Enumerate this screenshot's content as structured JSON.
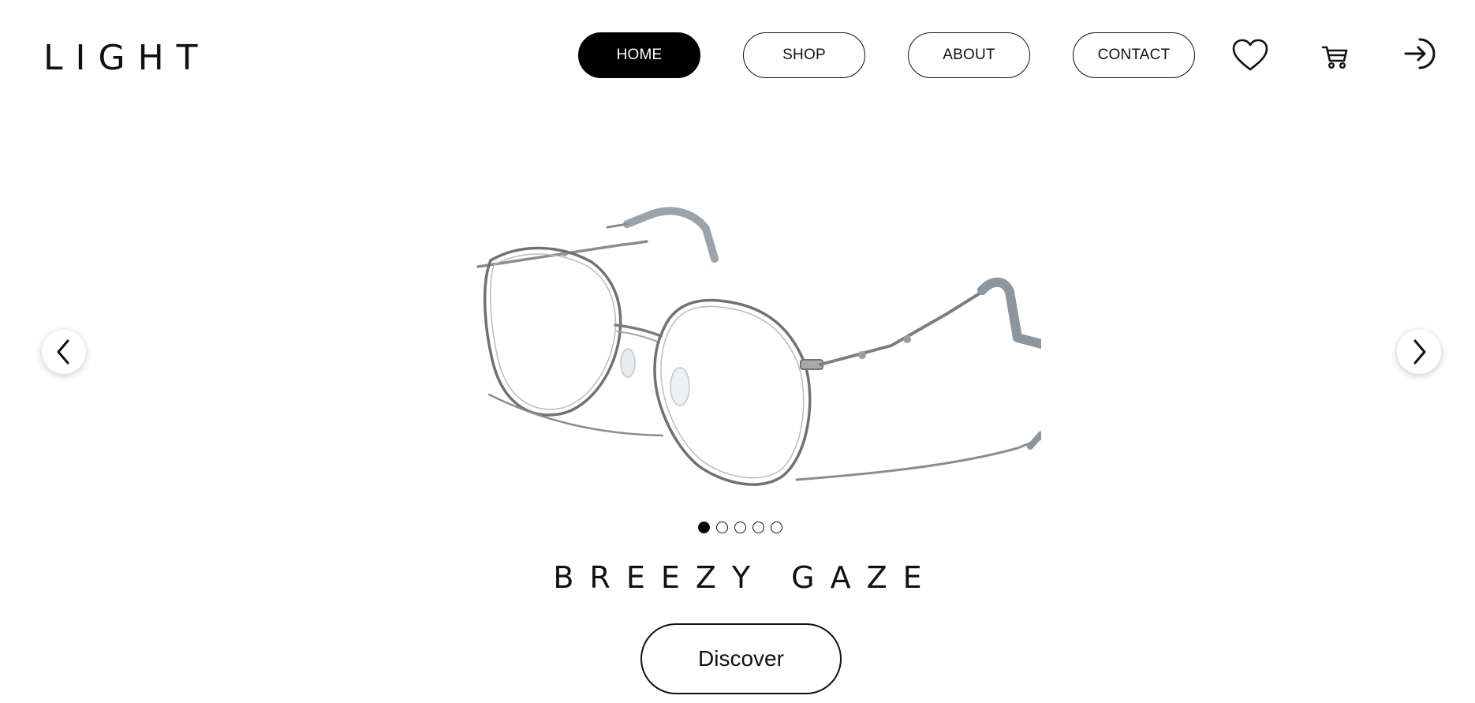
{
  "brand": {
    "logo": "LIGHT"
  },
  "nav": {
    "items": [
      {
        "label": "HOME",
        "active": true
      },
      {
        "label": "SHOP",
        "active": false
      },
      {
        "label": "ABOUT",
        "active": false
      },
      {
        "label": "CONTACT",
        "active": false
      }
    ]
  },
  "header_icons": [
    "heart-icon",
    "cart-icon",
    "login-icon"
  ],
  "carousel": {
    "prev_icon": "chevron-left-icon",
    "next_icon": "chevron-right-icon",
    "slide_count": 5,
    "active_slide": 1,
    "image": "silver-wire-frame-glasses",
    "title": "BREEZY GAZE",
    "cta_label": "Discover"
  },
  "colors": {
    "primary": "#000000",
    "background": "#ffffff",
    "frame_metal": "#8a8d90",
    "temple_tip": "#8c969c"
  }
}
